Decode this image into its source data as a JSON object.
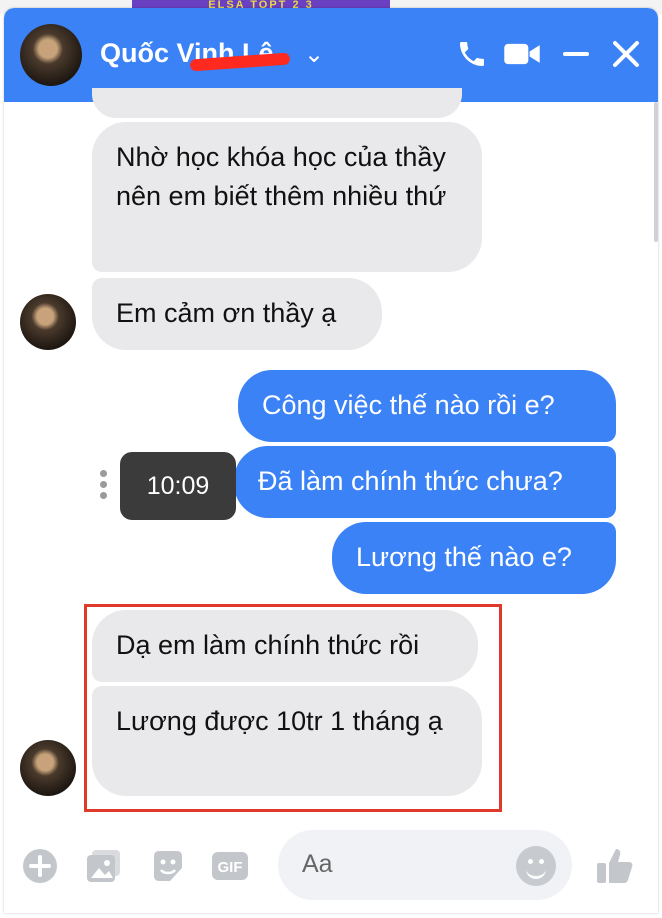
{
  "banner": {
    "text": "ELSA TOPT 2 3"
  },
  "header": {
    "name": "Quốc Vinh Lê"
  },
  "messages": [
    {
      "text": ""
    },
    {
      "text": "Nhờ học khóa học của thầy nên em biết thêm nhiều thứ"
    },
    {
      "text": "Em cảm ơn thầy ạ"
    },
    {
      "text": "Công việc thế nào rồi e?"
    },
    {
      "text": "Đã làm chính thức chưa?"
    },
    {
      "text": "Lương thế nào e?"
    },
    {
      "text": "Dạ em làm chính thức rồi"
    },
    {
      "text": "Lương được 10tr 1 tháng ạ"
    }
  ],
  "tooltip": {
    "time": "10:09"
  },
  "composer": {
    "placeholder": "Aa"
  },
  "colors": {
    "header": "#3b82f6",
    "outgoing": "#3b82f6",
    "incoming": "#e9e9eb",
    "highlight": "#e03a2a"
  }
}
